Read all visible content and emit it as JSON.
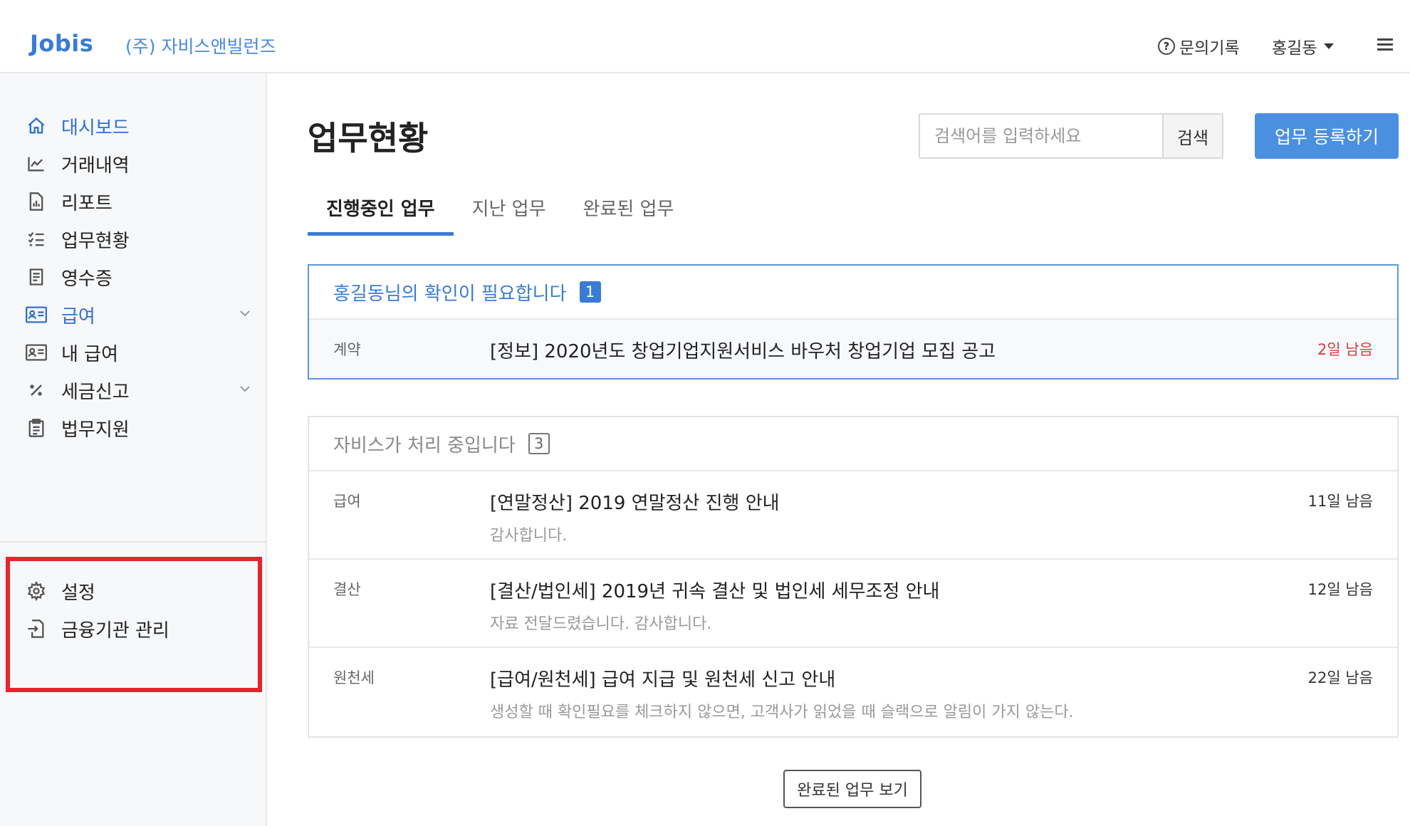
{
  "header": {
    "logo": "Jobis",
    "company": "(주) 자비스앤빌런즈",
    "inquiry_label": "문의기록",
    "user_name": "홍길동"
  },
  "sidebar": {
    "items": [
      {
        "label": "대시보드",
        "icon": "home-icon",
        "active": true
      },
      {
        "label": "거래내역",
        "icon": "chart-line-icon"
      },
      {
        "label": "리포트",
        "icon": "report-icon"
      },
      {
        "label": "업무현황",
        "icon": "checklist-icon"
      },
      {
        "label": "영수증",
        "icon": "receipt-icon"
      },
      {
        "label": "급여",
        "icon": "id-card-icon",
        "active": true,
        "expandable": true
      },
      {
        "label": "내 급여",
        "icon": "id-card-icon"
      },
      {
        "label": "세금신고",
        "icon": "percent-icon",
        "expandable": true
      },
      {
        "label": "법무지원",
        "icon": "clipboard-icon"
      }
    ],
    "bottom_items": [
      {
        "label": "설정",
        "icon": "gear-icon"
      },
      {
        "label": "금융기관 관리",
        "icon": "file-import-icon"
      }
    ]
  },
  "main": {
    "title": "업무현황",
    "search": {
      "placeholder": "검색어를 입력하세요",
      "button": "검색"
    },
    "register_button": "업무 등록하기",
    "tabs": [
      "진행중인 업무",
      "지난 업무",
      "완료된 업무"
    ],
    "confirm_section": {
      "title": "홍길동님의 확인이 필요합니다",
      "count": "1",
      "rows": [
        {
          "category": "계약",
          "title": "[정보] 2020년도 창업기업지원서비스 바우처 창업기업 모집 공고",
          "due": "2일 남음"
        }
      ]
    },
    "processing_section": {
      "title": "자비스가 처리 중입니다",
      "count": "3",
      "rows": [
        {
          "category": "급여",
          "title": "[연말정산] 2019 연말정산 진행 안내",
          "desc": "감사합니다.",
          "due": "11일 남음"
        },
        {
          "category": "결산",
          "title": "[결산/법인세] 2019년 귀속 결산 및 법인세 세무조정 안내",
          "desc": "자료 전달드렸습니다. 감사합니다.",
          "due": "12일 남음"
        },
        {
          "category": "원천세",
          "title": "[급여/원천세] 급여 지급 및 원천세 신고 안내",
          "desc": "생성할 때 확인필요를 체크하지 않으면, 고객사가 읽었을 때 슬랙으로 알림이 가지 않는다.",
          "due": "22일 남음"
        }
      ]
    },
    "view_completed_button": "완료된 업무 보기"
  },
  "colors": {
    "brand": "#3a7bd5",
    "primary_button": "#4a8fe0",
    "urgent": "#d93a3a",
    "highlight_box": "#e8232b"
  }
}
